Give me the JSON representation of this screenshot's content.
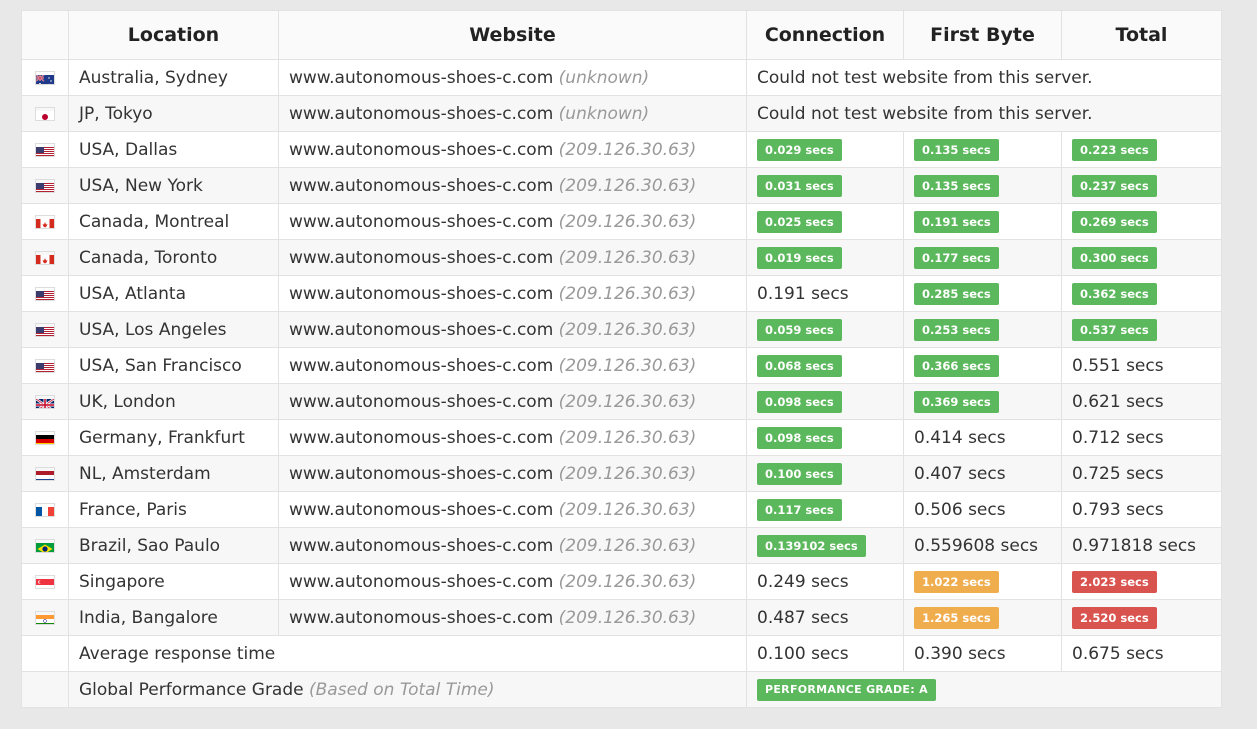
{
  "columns": {
    "flag": "",
    "location": "Location",
    "website": "Website",
    "connection": "Connection",
    "first_byte": "First Byte",
    "total": "Total"
  },
  "rows": [
    {
      "flag": "au-flag-icon",
      "location": "Australia, Sydney",
      "site": "www.autonomous-shoes-c.com",
      "ip": "(unknown)",
      "message": "Could not test website from this server."
    },
    {
      "flag": "jp-flag-icon",
      "location": "JP, Tokyo",
      "site": "www.autonomous-shoes-c.com",
      "ip": "(unknown)",
      "message": "Could not test website from this server."
    },
    {
      "flag": "us-flag-icon",
      "location": "USA, Dallas",
      "site": "www.autonomous-shoes-c.com",
      "ip": "(209.126.30.63)",
      "connection": "0.029 secs",
      "connection_status": "good",
      "first_byte": "0.135 secs",
      "first_byte_status": "good",
      "total": "0.223 secs",
      "total_status": "good"
    },
    {
      "flag": "us-flag-icon",
      "location": "USA, New York",
      "site": "www.autonomous-shoes-c.com",
      "ip": "(209.126.30.63)",
      "connection": "0.031 secs",
      "connection_status": "good",
      "first_byte": "0.135 secs",
      "first_byte_status": "good",
      "total": "0.237 secs",
      "total_status": "good"
    },
    {
      "flag": "ca-flag-icon",
      "location": "Canada, Montreal",
      "site": "www.autonomous-shoes-c.com",
      "ip": "(209.126.30.63)",
      "connection": "0.025 secs",
      "connection_status": "good",
      "first_byte": "0.191 secs",
      "first_byte_status": "good",
      "total": "0.269 secs",
      "total_status": "good"
    },
    {
      "flag": "ca-flag-icon",
      "location": "Canada, Toronto",
      "site": "www.autonomous-shoes-c.com",
      "ip": "(209.126.30.63)",
      "connection": "0.019 secs",
      "connection_status": "good",
      "first_byte": "0.177 secs",
      "first_byte_status": "good",
      "total": "0.300 secs",
      "total_status": "good"
    },
    {
      "flag": "us-flag-icon",
      "location": "USA, Atlanta",
      "site": "www.autonomous-shoes-c.com",
      "ip": "(209.126.30.63)",
      "connection": "0.191 secs",
      "connection_status": "plain",
      "first_byte": "0.285 secs",
      "first_byte_status": "good",
      "total": "0.362 secs",
      "total_status": "good"
    },
    {
      "flag": "us-flag-icon",
      "location": "USA, Los Angeles",
      "site": "www.autonomous-shoes-c.com",
      "ip": "(209.126.30.63)",
      "connection": "0.059 secs",
      "connection_status": "good",
      "first_byte": "0.253 secs",
      "first_byte_status": "good",
      "total": "0.537 secs",
      "total_status": "good"
    },
    {
      "flag": "us-flag-icon",
      "location": "USA, San Francisco",
      "site": "www.autonomous-shoes-c.com",
      "ip": "(209.126.30.63)",
      "connection": "0.068 secs",
      "connection_status": "good",
      "first_byte": "0.366 secs",
      "first_byte_status": "good",
      "total": "0.551 secs",
      "total_status": "plain"
    },
    {
      "flag": "uk-flag-icon",
      "location": "UK, London",
      "site": "www.autonomous-shoes-c.com",
      "ip": "(209.126.30.63)",
      "connection": "0.098 secs",
      "connection_status": "good",
      "first_byte": "0.369 secs",
      "first_byte_status": "good",
      "total": "0.621 secs",
      "total_status": "plain"
    },
    {
      "flag": "de-flag-icon",
      "location": "Germany, Frankfurt",
      "site": "www.autonomous-shoes-c.com",
      "ip": "(209.126.30.63)",
      "connection": "0.098 secs",
      "connection_status": "good",
      "first_byte": "0.414 secs",
      "first_byte_status": "plain",
      "total": "0.712 secs",
      "total_status": "plain"
    },
    {
      "flag": "nl-flag-icon",
      "location": "NL, Amsterdam",
      "site": "www.autonomous-shoes-c.com",
      "ip": "(209.126.30.63)",
      "connection": "0.100 secs",
      "connection_status": "good",
      "first_byte": "0.407 secs",
      "first_byte_status": "plain",
      "total": "0.725 secs",
      "total_status": "plain"
    },
    {
      "flag": "fr-flag-icon",
      "location": "France, Paris",
      "site": "www.autonomous-shoes-c.com",
      "ip": "(209.126.30.63)",
      "connection": "0.117 secs",
      "connection_status": "good",
      "first_byte": "0.506 secs",
      "first_byte_status": "plain",
      "total": "0.793 secs",
      "total_status": "plain"
    },
    {
      "flag": "br-flag-icon",
      "location": "Brazil, Sao Paulo",
      "site": "www.autonomous-shoes-c.com",
      "ip": "(209.126.30.63)",
      "connection": "0.139102 secs",
      "connection_status": "good",
      "first_byte": "0.559608 secs",
      "first_byte_status": "plain",
      "total": "0.971818 secs",
      "total_status": "plain"
    },
    {
      "flag": "sg-flag-icon",
      "location": "Singapore",
      "site": "www.autonomous-shoes-c.com",
      "ip": "(209.126.30.63)",
      "connection": "0.249 secs",
      "connection_status": "plain",
      "first_byte": "1.022 secs",
      "first_byte_status": "warn",
      "total": "2.023 secs",
      "total_status": "bad"
    },
    {
      "flag": "in-flag-icon",
      "location": "India, Bangalore",
      "site": "www.autonomous-shoes-c.com",
      "ip": "(209.126.30.63)",
      "connection": "0.487 secs",
      "connection_status": "plain",
      "first_byte": "1.265 secs",
      "first_byte_status": "warn",
      "total": "2.520 secs",
      "total_status": "bad"
    }
  ],
  "average": {
    "label": "Average response time",
    "connection": "0.100 secs",
    "first_byte": "0.390 secs",
    "total": "0.675 secs"
  },
  "grade": {
    "label": "Global Performance Grade",
    "note": "(Based on Total Time)",
    "badge_label": "PERFORMANCE GRADE:",
    "value": "A"
  },
  "colors": {
    "good": "#5cb85c",
    "warn": "#f0ad4e",
    "bad": "#d9534f"
  }
}
